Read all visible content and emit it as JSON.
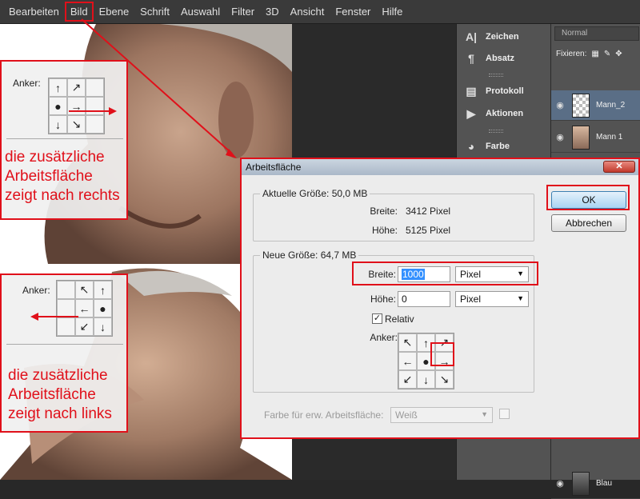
{
  "menubar": {
    "items": [
      "Bearbeiten",
      "Bild",
      "Ebene",
      "Schrift",
      "Auswahl",
      "Filter",
      "3D",
      "Ansicht",
      "Fenster",
      "Hilfe"
    ],
    "highlighted": "Bild"
  },
  "panels": {
    "zeichen": "Zeichen",
    "absatz": "Absatz",
    "protokoll": "Protokoll",
    "aktionen": "Aktionen",
    "farbe": "Farbe"
  },
  "layers": {
    "blend_mode": "Normal",
    "fixieren_label": "Fixieren:",
    "items": [
      "Mann_2",
      "Mann 1",
      "Blau"
    ]
  },
  "annotation_top": {
    "anker_label": "Anker:",
    "text_lines": [
      "die zusätzliche",
      "Arbeitsfläche",
      "zeigt nach rechts"
    ]
  },
  "annotation_bottom": {
    "anker_label": "Anker:",
    "text_lines": [
      "die zusätzliche",
      "Arbeitsfläche",
      "zeigt nach links"
    ]
  },
  "dialog": {
    "title": "Arbeitsfläche",
    "current": {
      "group_title": "Aktuelle Größe: 50,0 MB",
      "width_label": "Breite:",
      "width_value": "3412 Pixel",
      "height_label": "Höhe:",
      "height_value": "5125 Pixel"
    },
    "new": {
      "group_title": "Neue Größe: 64,7 MB",
      "width_label": "Breite:",
      "width_value": "1000",
      "width_unit": "Pixel",
      "height_label": "Höhe:",
      "height_value": "0",
      "height_unit": "Pixel",
      "relative_label": "Relativ",
      "relative_checked": true,
      "anchor_label": "Anker:"
    },
    "extension_color_label": "Farbe für erw. Arbeitsfläche:",
    "extension_color_value": "Weiß",
    "ok_label": "OK",
    "cancel_label": "Abbrechen"
  },
  "colors": {
    "highlight_red": "#e0101a",
    "menu_bg": "#3a3a3a",
    "panel_bg": "#535353"
  }
}
